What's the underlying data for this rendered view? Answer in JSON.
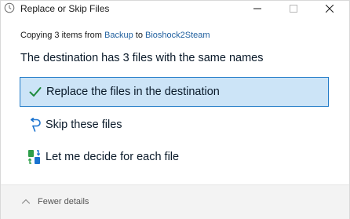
{
  "window": {
    "title": "Replace or Skip Files"
  },
  "dialog": {
    "copy_prefix": "Copying 3 items from",
    "source": "Backup",
    "copy_to": "to",
    "destination": "Bioshock2Steam",
    "heading": "The destination has 3 files with the same names",
    "options": [
      {
        "label": "Replace the files in the destination",
        "icon": "checkmark-icon",
        "selected": true
      },
      {
        "label": "Skip these files",
        "icon": "skip-icon",
        "selected": false
      },
      {
        "label": "Let me decide for each file",
        "icon": "compare-files-icon",
        "selected": false
      }
    ],
    "details_toggle": "Fewer details"
  },
  "colors": {
    "accent": "#1f7ac7",
    "selected_bg": "#cce4f7",
    "link": "#1f5f9e",
    "check": "#1e8a3c"
  }
}
